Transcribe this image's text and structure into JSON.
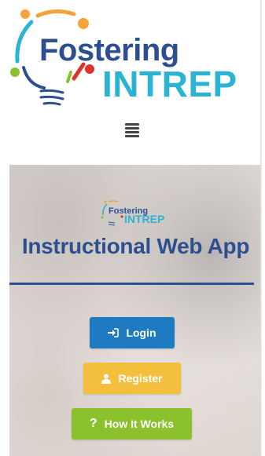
{
  "logo": {
    "word1": "Fostering",
    "word2": "INTREP",
    "colors": {
      "dark_blue": "#2d4f8f",
      "cyan": "#2bb3d4",
      "green": "#8cc12e",
      "orange": "#f3a43a",
      "red": "#e0312b"
    }
  },
  "nav": {
    "menu_icon": "hamburger-menu-icon"
  },
  "hero": {
    "logo_word1": "Fostering",
    "logo_word2": "INTREP",
    "title": "Instructional Web App"
  },
  "buttons": {
    "login": {
      "label": "Login",
      "icon": "sign-in-icon",
      "color": "#1f7bc1"
    },
    "register": {
      "label": "Register",
      "icon": "user-icon",
      "color": "#f3bf3d"
    },
    "how": {
      "label": "How It Works",
      "icon": "question-icon",
      "color": "#8cc12e"
    }
  }
}
